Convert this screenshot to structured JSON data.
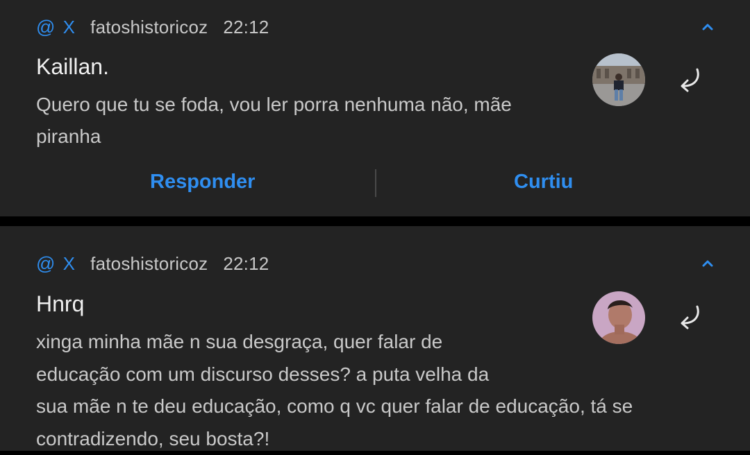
{
  "notifications": [
    {
      "account": "fatoshistoricoz",
      "time": "22:12",
      "author": "Kaillan.",
      "lines": [
        "Quero que tu se foda, vou ler porra nenhuma não, mãe",
        "piranha"
      ],
      "actions": {
        "reply_label": "Responder",
        "liked_label": "Curtiu"
      }
    },
    {
      "account": "fatoshistoricoz",
      "time": "22:12",
      "author": "Hnrq",
      "lines": [
        "xinga minha mãe n sua desgraça, quer falar de",
        "educação com um discurso desses? a puta velha da",
        "sua mãe n te deu educação, como q vc quer falar de educação, tá se",
        "contradizendo, seu bosta?!"
      ]
    }
  ],
  "icons": {
    "mention": "@",
    "platform": "X",
    "collapse": "chevron-up-icon",
    "reply": "reply-arrow-icon"
  },
  "colors": {
    "accent": "#2f8ef0",
    "card_bg": "#232323",
    "separator": "#000000"
  }
}
